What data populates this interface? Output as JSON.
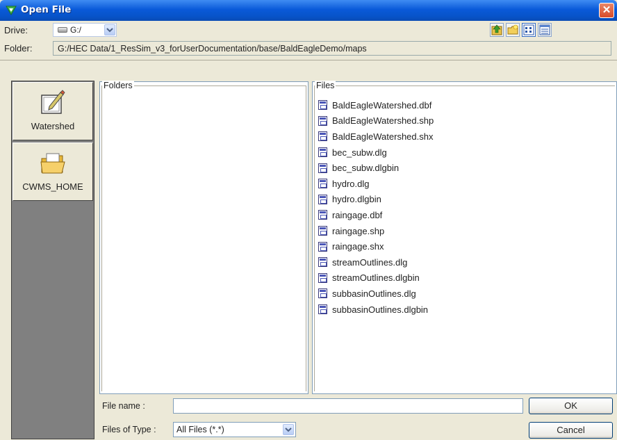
{
  "window": {
    "title": "Open File",
    "close_glyph": "✕"
  },
  "drive": {
    "label": "Drive:",
    "value": "G:/"
  },
  "toolbar": {
    "icons": [
      "up-folder-icon",
      "new-folder-icon",
      "list-view-icon",
      "details-view-icon"
    ]
  },
  "folder": {
    "label": "Folder:",
    "path": "G:/HEC Data/1_ResSim_v3_forUserDocumentation/base/BaldEagleDemo/maps"
  },
  "shortcuts": [
    {
      "label": "Watershed",
      "icon": "watershed-icon"
    },
    {
      "label": "CWMS_HOME",
      "icon": "open-folder-icon"
    }
  ],
  "folders_panel": {
    "title": "Folders"
  },
  "files_panel": {
    "title": "Files",
    "files": [
      "BaldEagleWatershed.dbf",
      "BaldEagleWatershed.shp",
      "BaldEagleWatershed.shx",
      "bec_subw.dlg",
      "bec_subw.dlgbin",
      "hydro.dlg",
      "hydro.dlgbin",
      "raingage.dbf",
      "raingage.shp",
      "raingage.shx",
      "streamOutlines.dlg",
      "streamOutlines.dlgbin",
      "subbasinOutlines.dlg",
      "subbasinOutlines.dlgbin"
    ]
  },
  "filename": {
    "label": "File name :",
    "value": ""
  },
  "filetype": {
    "label": "Files of Type :",
    "value": "All Files (*.*)"
  },
  "buttons": {
    "ok": "OK",
    "cancel": "Cancel"
  },
  "colors": {
    "titlebar": "#0a5ad9",
    "sidebar_bg": "#808080",
    "dialog_bg": "#ece9d8",
    "close": "#d84a28"
  }
}
